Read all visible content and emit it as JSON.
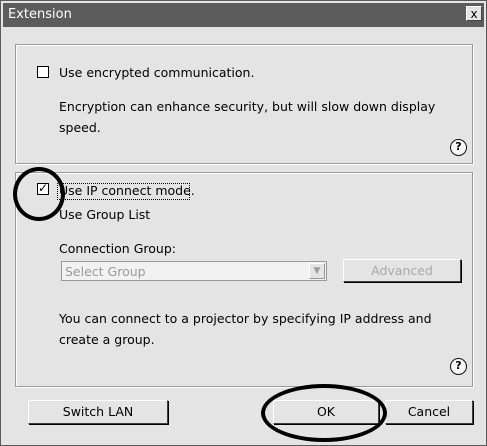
{
  "window": {
    "title": "Extension",
    "close_glyph": "x",
    "close_icon": "close-icon"
  },
  "encryption": {
    "checkbox_label": "Use encrypted communication.",
    "checked": false,
    "description_line1": "Encryption can enhance security, but will slow down display",
    "description_line2": "speed.",
    "help_glyph": "?"
  },
  "ip_connect": {
    "checkbox_label": "Use IP connect mode.",
    "checked": true,
    "check_glyph": "✓",
    "group_list_label": "Use Group List",
    "group_list_checked": false,
    "connection_group_label": "Connection Group:",
    "select_placeholder": "Select Group",
    "advanced_label": "Advanced",
    "description_line1": "You can connect to a projector by specifying IP address and",
    "description_line2": "create a group.",
    "help_glyph": "?",
    "dropdown_glyph": "▼"
  },
  "buttons": {
    "switch_lan": "Switch LAN",
    "ok": "OK",
    "cancel": "Cancel"
  },
  "colors": {
    "title_bar": "#5c5c5c",
    "dialog_bg": "#e4e4e4",
    "disabled_text": "#9a9a9a"
  }
}
